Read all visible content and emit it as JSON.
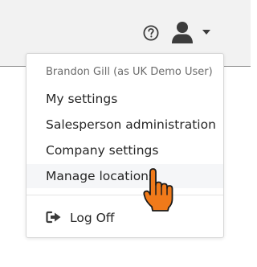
{
  "header": {
    "help_icon": "question-circle-icon",
    "user_icon": "user-icon",
    "dropdown_icon": "caret-down-icon"
  },
  "user_menu": {
    "user_label": "Brandon Gill (as UK Demo User)",
    "items": [
      {
        "label": "My settings"
      },
      {
        "label": "Salesperson administration"
      },
      {
        "label": "Company settings"
      },
      {
        "label": "Manage locations",
        "hovered": true
      }
    ],
    "logoff": {
      "label": "Log Off",
      "icon": "sign-out-icon"
    }
  },
  "cursor": {
    "icon": "hand-pointer-icon",
    "color": "#f07a1a"
  },
  "colors": {
    "topbar_bg": "#f2f2f2",
    "icon_gray": "#3c3c3c",
    "hover_bg": "#f5f6f8"
  }
}
